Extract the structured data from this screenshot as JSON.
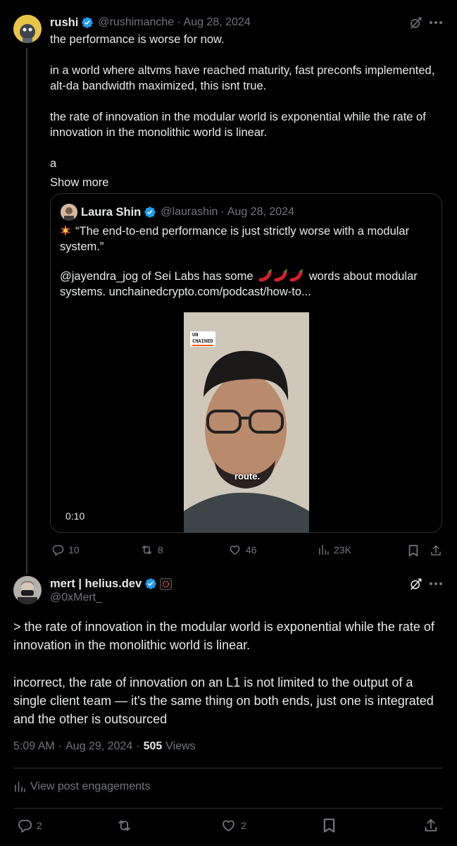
{
  "post1": {
    "display_name": "rushi",
    "handle": "@rushimanche",
    "date": "Aug 28, 2024",
    "paragraphs": [
      "the performance is worse for now.",
      "in a world where altvms have reached maturity, fast preconfs implemented, alt-da bandwidth maximized, this isnt true.",
      "the rate of innovation in the modular world is exponential while the rate of innovation in the monolithic world is linear.",
      "a"
    ],
    "show_more": "Show more",
    "quote": {
      "display_name": "Laura Shin",
      "handle": "@laurashin",
      "date": "Aug 28, 2024",
      "line1": "“The end-to-end performance is just strictly worse with a modular system.”",
      "line2a": "@jayendra_jog of Sei Labs has some",
      "line2b": "words about modular systems. unchainedcrypto.com/podcast/how-to...",
      "video_brand_top": "UN",
      "video_brand_bottom": "CHAINED",
      "caption": "route.",
      "duration": "0:10"
    },
    "stats": {
      "replies": "10",
      "reposts": "8",
      "likes": "46",
      "views": "23K"
    }
  },
  "post2": {
    "display_name": "mert | helius.dev",
    "handle": "@0xMert_",
    "paragraph1": "> the rate of innovation in the modular world is exponential while the rate of innovation in the monolithic world is linear.",
    "paragraph2": "incorrect, the rate of innovation on an L1 is not limited to the output of a single client team — it's the same thing on both ends, just one is integrated and the other is outsourced",
    "time": "5:09 AM",
    "date": "Aug 29, 2024",
    "views_count": "505",
    "views_label": "Views",
    "engagements": "View post engagements",
    "stats": {
      "replies": "2",
      "likes": "2"
    }
  },
  "colors": {
    "background": "#000000",
    "text": "#e7e9ea",
    "muted": "#71767b",
    "accent": "#1d9bf0",
    "border": "#2f3336"
  },
  "icons": [
    "verified-badge-icon",
    "grok-icon",
    "more-icon",
    "reply-icon",
    "repost-icon",
    "like-icon",
    "views-icon",
    "bookmark-icon",
    "share-icon",
    "pepper-icon",
    "sparkle-icon",
    "analytics-icon"
  ]
}
